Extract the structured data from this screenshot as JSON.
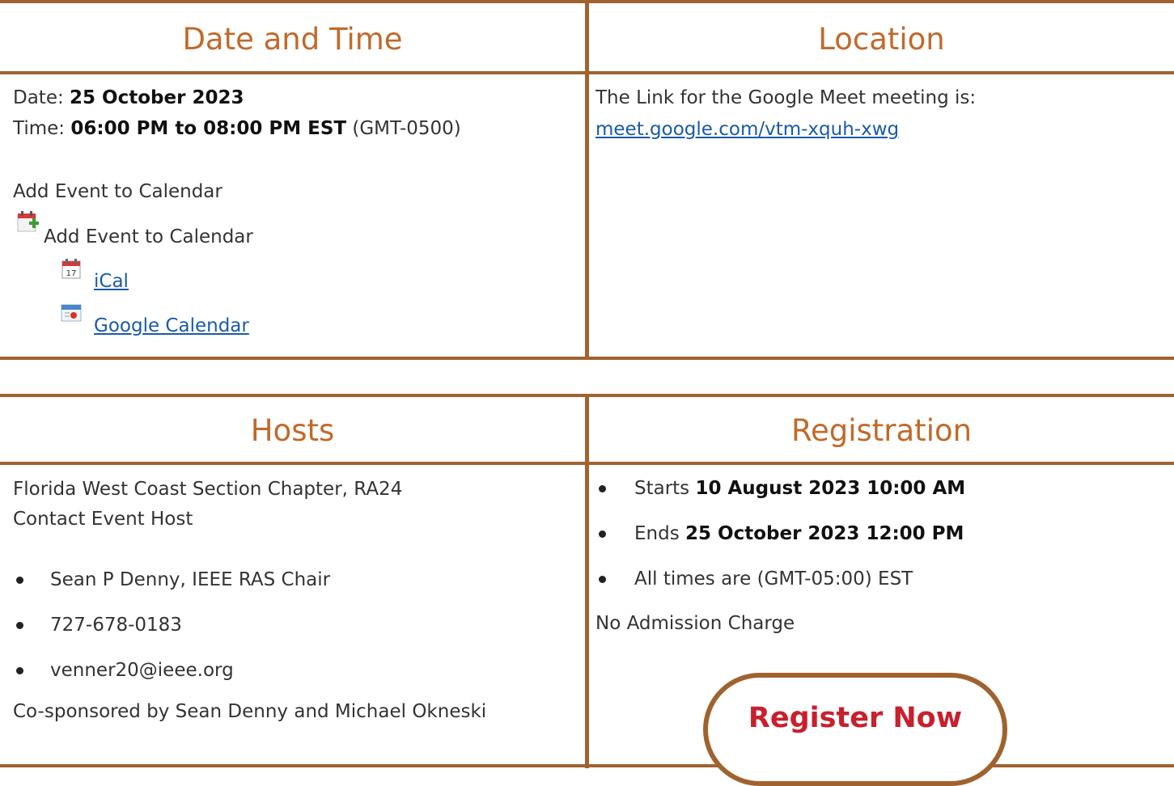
{
  "date_time": {
    "header": "Date and Time",
    "date_label": "Date: ",
    "date_value": "25 October 2023",
    "time_label": "Time: ",
    "time_value": "06:00 PM to 08:00 PM EST",
    "timezone": " (GMT-0500)",
    "add_event_title": "Add Event to Calendar",
    "add_event_menu": "Add Event to Calendar",
    "ical_link": "iCal",
    "google_calendar_link": "Google Calendar"
  },
  "location": {
    "header": "Location",
    "text": "The Link for the Google Meet meeting is:",
    "link": "meet.google.com/vtm-xquh-xwg"
  },
  "hosts": {
    "header": "Hosts",
    "organization": "Florida West Coast Section Chapter, RA24",
    "contact_label": "Contact Event Host",
    "contacts": [
      "Sean P Denny, IEEE RAS Chair",
      "727-678-0183",
      "venner20@ieee.org"
    ],
    "cosponsors": "Co-sponsored by Sean Denny and Michael Okneski"
  },
  "registration": {
    "header": "Registration",
    "starts_label": "Starts ",
    "starts_value": "10 August 2023 10:00 AM",
    "ends_label": "Ends ",
    "ends_value": "25 October 2023 12:00 PM",
    "timezone_note": "All times are (GMT-05:00) EST",
    "admission": "No Admission Charge",
    "register_button": "Register Now"
  },
  "colors": {
    "accent": "#a0622f",
    "header_text": "#c06a2b",
    "link": "#1a5aa8",
    "button_text": "#c8202d"
  }
}
